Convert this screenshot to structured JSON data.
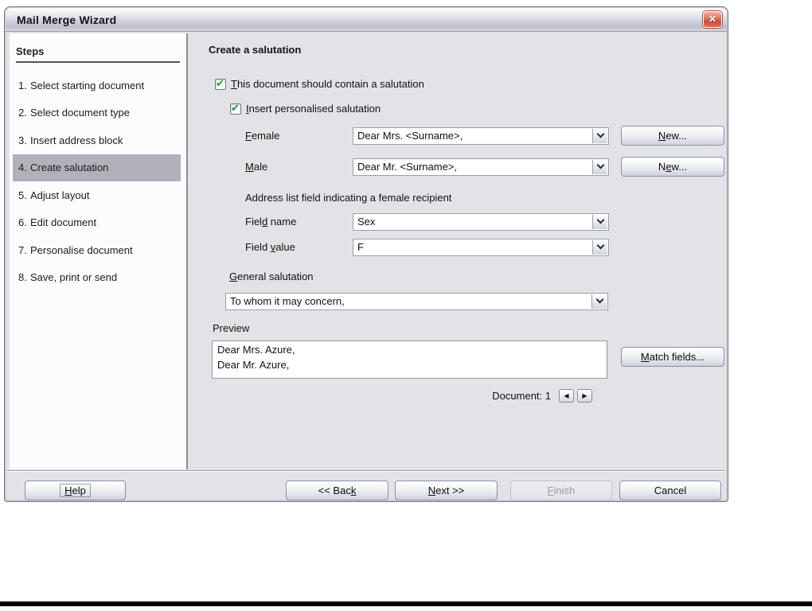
{
  "window": {
    "title": "Mail Merge Wizard",
    "close_icon": "✕"
  },
  "colors": {
    "check_green": "#189c36",
    "close_button_red": "#d8604c",
    "active_step_bg": "#b1b1b9",
    "dialog_gray": "#e3e3e7"
  },
  "sidebar": {
    "header": "Steps",
    "items": [
      {
        "num": "1.",
        "label": "Select starting document"
      },
      {
        "num": "2.",
        "label": "Select document type"
      },
      {
        "num": "3.",
        "label": "Insert address block"
      },
      {
        "num": "4.",
        "label": "Create salutation"
      },
      {
        "num": "5.",
        "label": "Adjust layout"
      },
      {
        "num": "6.",
        "label": "Edit document"
      },
      {
        "num": "7.",
        "label": "Personalise document"
      },
      {
        "num": "8.",
        "label": "Save, print or send"
      }
    ],
    "active_index": 3
  },
  "main": {
    "heading": "Create a salutation",
    "check_glyph": "✔",
    "cb_contain": {
      "pre": "",
      "key": "T",
      "post": "his document should contain a salutation",
      "checked": true
    },
    "cb_personalised": {
      "pre": "",
      "key": "I",
      "post": "nsert personalised salutation",
      "checked": true
    },
    "female_label": {
      "pre": "",
      "key": "F",
      "post": "emale"
    },
    "female_value": "Dear Mrs. <Surname>,",
    "female_new": {
      "pre": "",
      "key": "N",
      "post": "ew..."
    },
    "male_label": {
      "pre": "",
      "key": "M",
      "post": "ale"
    },
    "male_value": "Dear Mr. <Surname>,",
    "male_new": {
      "pre": "N",
      "key": "e",
      "post": "w..."
    },
    "address_note": "Address list field indicating a female recipient",
    "field_name_label": {
      "pre": "Fiel",
      "key": "d",
      "post": " name"
    },
    "field_name_value": "Sex",
    "field_value_label": {
      "pre": "Field ",
      "key": "v",
      "post": "alue"
    },
    "field_value_value": "F",
    "general_label": {
      "pre": "",
      "key": "G",
      "post": "eneral salutation"
    },
    "general_value": "To whom it may concern,",
    "preview_label": "Preview",
    "preview_line1": "Dear Mrs. Azure,",
    "preview_line2": "Dear Mr. Azure,",
    "match_fields": {
      "pre": "",
      "key": "M",
      "post": "atch fields..."
    },
    "doc_nav": {
      "label": "Document: 1",
      "prev_icon": "◀",
      "next_icon": "▶"
    }
  },
  "footer": {
    "help": {
      "pre": "",
      "key": "H",
      "post": "elp"
    },
    "back": {
      "pre": "<< Bac",
      "key": "k",
      "post": ""
    },
    "next": {
      "pre": "",
      "key": "N",
      "post": "ext >>"
    },
    "finish": {
      "pre": "",
      "key": "F",
      "post": "inish"
    },
    "cancel": {
      "pre": "Cancel",
      "key": "",
      "post": ""
    }
  }
}
